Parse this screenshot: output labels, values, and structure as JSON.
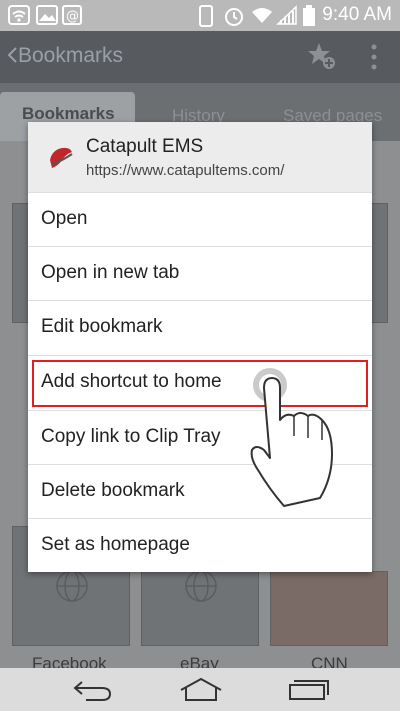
{
  "status_bar": {
    "time": "9:40 AM",
    "icons": [
      "wifi-alt-icon",
      "image-icon",
      "email-icon",
      "phone-icon",
      "alarm-icon",
      "wifi-icon",
      "signal-icon",
      "battery-icon"
    ]
  },
  "app_bar": {
    "title": "Bookmarks"
  },
  "tabs": [
    {
      "label": "Bookmarks"
    },
    {
      "label": "History"
    },
    {
      "label": "Saved pages"
    }
  ],
  "grid": {
    "labels": [
      "Facebook",
      "eBay",
      "CNN"
    ]
  },
  "dialog": {
    "title": "Catapult EMS",
    "url": "https://www.catapultems.com/",
    "items": [
      {
        "label": "Open"
      },
      {
        "label": "Open in new tab"
      },
      {
        "label": "Edit bookmark"
      },
      {
        "label": "Add shortcut to home"
      },
      {
        "label": "Copy link to Clip Tray"
      },
      {
        "label": "Delete bookmark"
      },
      {
        "label": "Set as homepage"
      }
    ]
  },
  "colors": {
    "highlight": "#e02020",
    "appbar": "#575a5e",
    "statusbar": "#b9b9b9"
  }
}
